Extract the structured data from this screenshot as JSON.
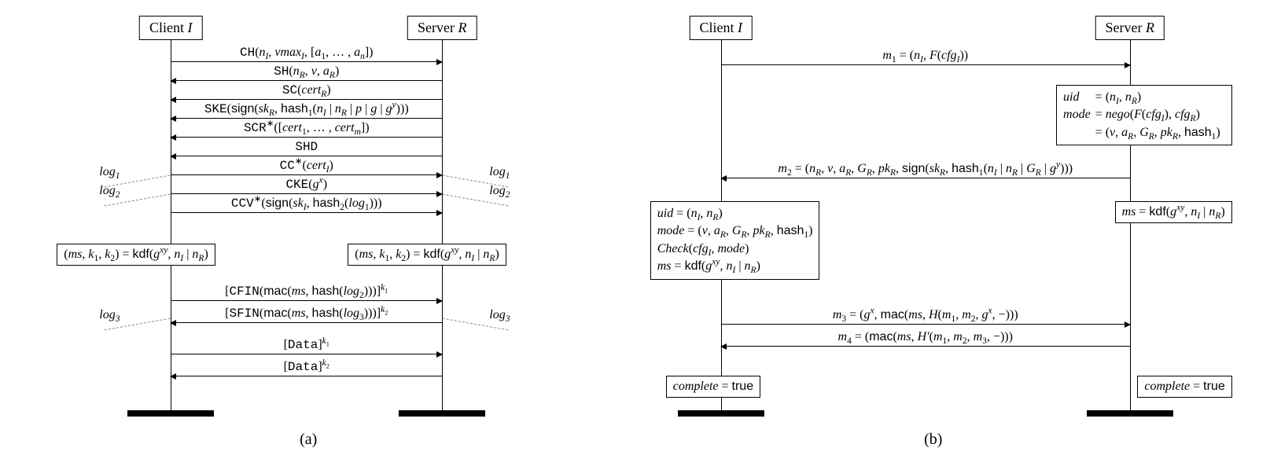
{
  "panelA": {
    "client": "Client <span class='it'>I</span>",
    "server": "Server <span class='it'>R</span>",
    "messages": {
      "ch": "<span class='tt'>CH</span>(<span class='it'>n<sub>I</sub></span>, <span class='it'>vmax<sub>I</sub></span>, [<span class='it'>a</span><sub>1</sub>, … , <span class='it'>a<sub>n</sub></span>])",
      "sh": "<span class='tt'>SH</span>(<span class='it'>n<sub>R</sub></span>, <span class='it'>v</span>, <span class='it'>a<sub>R</sub></span>)",
      "sc": "<span class='tt'>SC</span>(<span class='it'>cert<sub>R</sub></span>)",
      "ske": "<span class='tt'>SKE</span>(<span class='sf'>sign</span>(<span class='it'>sk<sub>R</sub></span>, <span class='sf'>hash</span><sub>1</sub>(<span class='it'>n<sub>I</sub></span> | <span class='it'>n<sub>R</sub></span> | <span class='it'>p</span> | <span class='it'>g</span> | <span class='it'>g<sup>y</sup></span>)))",
      "scr": "<span class='tt'>SCR</span><sup>∗</sup>([<span class='it'>cert</span><sub>1</sub>, … , <span class='it'>cert<sub>m</sub></span>])",
      "shd": "<span class='tt'>SHD</span>",
      "cc": "<span class='tt'>CC</span><sup>∗</sup>(<span class='it'>cert<sub>I</sub></span>)",
      "cke": "<span class='tt'>CKE</span>(<span class='it'>g<sup>x</sup></span>)",
      "ccv": "<span class='tt'>CCV</span><sup>∗</sup>(<span class='sf'>sign</span>(<span class='it'>sk<sub>I</sub></span>, <span class='sf'>hash</span><sub>2</sub>(<span class='it'>log</span><sub>1</sub>)))",
      "cfin": "[<span class='tt'>CFIN</span>(<span class='sf'>mac</span>(<span class='it'>ms</span>, <span class='sf'>hash</span>(<span class='it'>log</span><sub>2</sub>)))]<sup><span class='it'>k</span><sub>1</sub></sup>",
      "sfin": "[<span class='tt'>SFIN</span>(<span class='sf'>mac</span>(<span class='it'>ms</span>, <span class='sf'>hash</span>(<span class='it'>log</span><sub>3</sub>)))]<sup><span class='it'>k</span><sub>2</sub></sup>",
      "data1": "[<span class='tt'>Data</span>]<sup><span class='it'>k</span><sub>1</sub></sup>",
      "data2": "[<span class='tt'>Data</span>]<sup><span class='it'>k</span><sub>2</sub></sup>"
    },
    "kdf_left": "(<span class='it'>ms</span>, <span class='it'>k</span><sub>1</sub>, <span class='it'>k</span><sub>2</sub>) = <span class='sf'>kdf</span>(<span class='it'>g<sup>xy</sup></span>, <span class='it'>n<sub>I</sub></span> | <span class='it'>n<sub>R</sub></span>)",
    "kdf_right": "(<span class='it'>ms</span>, <span class='it'>k</span><sub>1</sub>, <span class='it'>k</span><sub>2</sub>) = <span class='sf'>kdf</span>(<span class='it'>g<sup>xy</sup></span>, <span class='it'>n<sub>I</sub></span> | <span class='it'>n<sub>R</sub></span>)",
    "logs": {
      "l1": "<span class='it'>log</span><sub>1</sub>",
      "l2": "<span class='it'>log</span><sub>2</sub>",
      "l3": "<span class='it'>log</span><sub>3</sub>"
    },
    "caption": "(a)"
  },
  "panelB": {
    "client": "Client <span class='it'>I</span>",
    "server": "Server <span class='it'>R</span>",
    "messages": {
      "m1": "<span class='it'>m</span><sub>1</sub> = (<span class='it'>n<sub>I</sub></span>, <span class='it'>F</span>(<span class='it'>cfg<sub>I</sub></span>))",
      "m2": "<span class='it'>m</span><sub>2</sub> = (<span class='it'>n<sub>R</sub></span>, <span class='it'>v</span>, <span class='it'>a<sub>R</sub></span>, <span class='it'>G<sub>R</sub></span>, <span class='it'>pk<sub>R</sub></span>, <span class='sf'>sign</span>(<span class='it'>sk<sub>R</sub></span>, <span class='sf'>hash</span><sub>1</sub>(<span class='it'>n<sub>I</sub></span> | <span class='it'>n<sub>R</sub></span> | <span class='it'>G<sub>R</sub></span> | <span class='it'>g<sup>y</sup></span>)))",
      "m3": "<span class='it'>m</span><sub>3</sub> = (<span class='it'>g<sup>x</sup></span>, <span class='sf'>mac</span>(<span class='it'>ms</span>, <span class='it'>H</span>(<span class='it'>m</span><sub>1</sub>, <span class='it'>m</span><sub>2</sub>, <span class='it'>g<sup>x</sup></span>, −)))",
      "m4": "<span class='it'>m</span><sub>4</sub> = (<span class='sf'>mac</span>(<span class='it'>ms</span>, <span class='it'>H′</span>(<span class='it'>m</span><sub>1</sub>, <span class='it'>m</span><sub>2</sub>, <span class='it'>m</span><sub>3</sub>, −)))"
    },
    "server_note": "<div class='row'><span class='cell it'>uid</span><span class='cell'>= (<span class='it'>n<sub>I</sub></span>, <span class='it'>n<sub>R</sub></span>)</span></div><div class='row'><span class='cell it'>mode</span><span class='cell'>= <span class='it'>nego</span>(<span class='it'>F</span>(<span class='it'>cfg<sub>I</sub></span>), <span class='it'>cfg<sub>R</sub></span>)</span></div><div class='row'><span class='cell'></span><span class='cell'>= (<span class='it'>v</span>, <span class='it'>a<sub>R</sub></span>, <span class='it'>G<sub>R</sub></span>, <span class='it'>pk<sub>R</sub></span>, <span class='sf'>hash</span><sub>1</sub>)</span></div>",
    "server_ms": "<span class='it'>ms</span> = <span class='sf'>kdf</span>(<span class='it'>g<sup>xy</sup></span>, <span class='it'>n<sub>I</sub></span> | <span class='it'>n<sub>R</sub></span>)",
    "client_note": "<span class='it'>uid</span> = (<span class='it'>n<sub>I</sub></span>, <span class='it'>n<sub>R</sub></span>)<br><span class='it'>mode</span> = (<span class='it'>v</span>, <span class='it'>a<sub>R</sub></span>, <span class='it'>G<sub>R</sub></span>, <span class='it'>pk<sub>R</sub></span>, <span class='sf'>hash</span><sub>1</sub>)<br><span class='it'>Check</span>(<span class='it'>cfg<sub>I</sub></span>, <span class='it'>mode</span>)<br><span class='it'>ms</span> = <span class='sf'>kdf</span>(<span class='it'>g<sup>xy</sup></span>, <span class='it'>n<sub>I</sub></span> | <span class='it'>n<sub>R</sub></span>)",
    "complete": "<span class='it'>complete</span> = <span class='sf'>true</span>",
    "caption": "(b)"
  }
}
